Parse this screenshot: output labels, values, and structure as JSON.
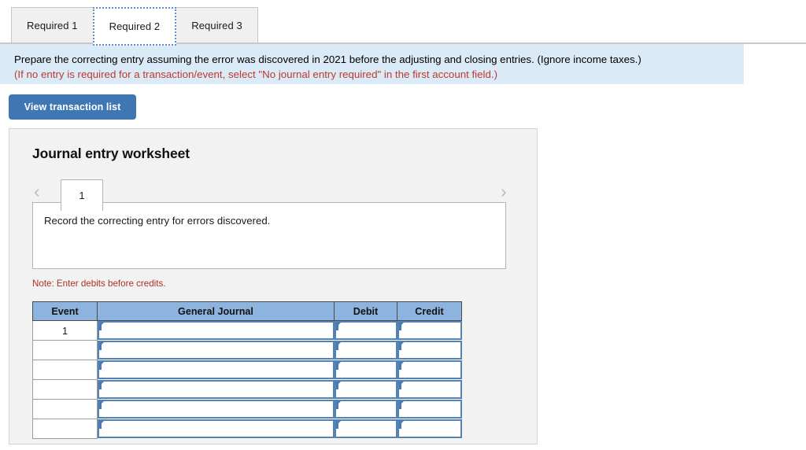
{
  "tabs": [
    {
      "label": "Required 1",
      "active": false
    },
    {
      "label": "Required 2",
      "active": true
    },
    {
      "label": "Required 3",
      "active": false
    }
  ],
  "instruction": {
    "primary": "Prepare the correcting entry assuming the error was discovered in 2021 before the adjusting and closing entries. (Ignore income taxes.)",
    "secondary": "(If no entry is required for a transaction/event, select \"No journal entry required\" in the first account field.)"
  },
  "toolbar": {
    "view_transaction_list_label": "View transaction list"
  },
  "worksheet": {
    "title": "Journal entry worksheet",
    "prev_icon": "chevron-left-icon",
    "next_icon": "chevron-right-icon",
    "prev_glyph": "‹",
    "next_glyph": "›",
    "entry_tabs": [
      "1"
    ],
    "record_description": "Record the correcting entry for errors discovered.",
    "note": "Note: Enter debits before credits."
  },
  "journal_table": {
    "headers": [
      "Event",
      "General Journal",
      "Debit",
      "Credit"
    ],
    "rows": [
      {
        "event": "1",
        "general_journal": "",
        "debit": "",
        "credit": ""
      },
      {
        "event": "",
        "general_journal": "",
        "debit": "",
        "credit": ""
      },
      {
        "event": "",
        "general_journal": "",
        "debit": "",
        "credit": ""
      },
      {
        "event": "",
        "general_journal": "",
        "debit": "",
        "credit": ""
      },
      {
        "event": "",
        "general_journal": "",
        "debit": "",
        "credit": ""
      },
      {
        "event": "",
        "general_journal": "",
        "debit": "",
        "credit": ""
      }
    ]
  },
  "colors": {
    "banner_bg": "#dbeaf7",
    "accent_blue": "#3f77b5",
    "table_header_bg": "#8cb4df",
    "note_red": "#a93226",
    "cell_border_blue": "#5582b4"
  }
}
